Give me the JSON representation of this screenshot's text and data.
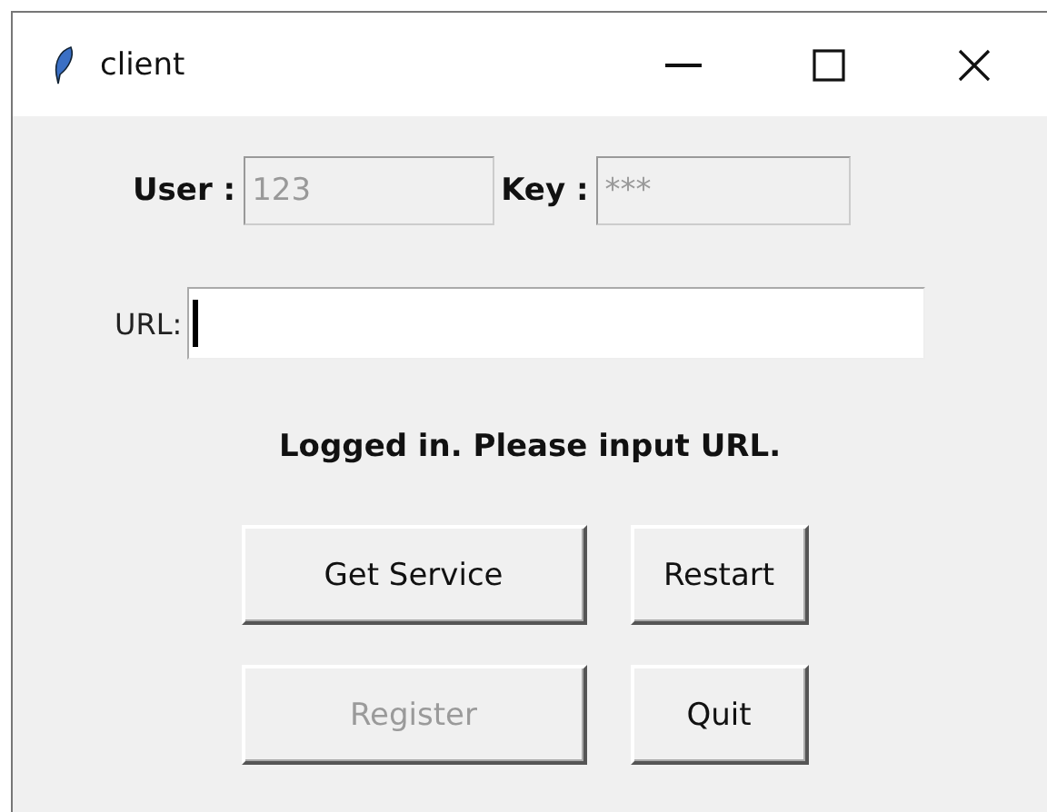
{
  "window": {
    "title": "client"
  },
  "login": [
    {
      "label": "User :",
      "value": "123",
      "disabled": true
    },
    {
      "label": "Key :",
      "value": "***",
      "disabled": true
    }
  ],
  "url": {
    "label": "URL:",
    "focused": true
  },
  "status": "Logged in. Please input URL.",
  "buttons": [
    {
      "label": "Get Service",
      "disabled": false
    },
    {
      "label": "Restart",
      "disabled": false
    },
    {
      "label": "Register",
      "disabled": true
    },
    {
      "label": "Quit",
      "disabled": false
    }
  ]
}
